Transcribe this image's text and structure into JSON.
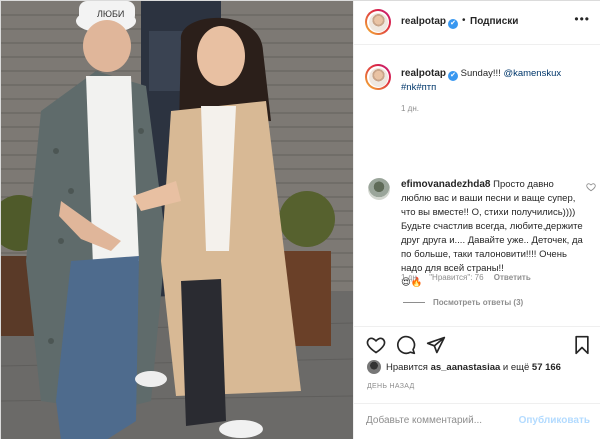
{
  "post": {
    "username": "realpotap",
    "follow_label": "Подписки",
    "dot": "•",
    "more": "•••",
    "verified_icon": "✔"
  },
  "caption": {
    "username": "realpotap",
    "text": "Sunday!!! ",
    "mention": "@kamenskux",
    "hashtags": "#nk#птп",
    "time": "1 дн."
  },
  "comment": {
    "username": "efimovanadezhda8",
    "text": "Просто давно люблю вас и ваши песни и ваще супер, что вы вместе!! О, стихи получились)))) Будьте счастлив всегда, любите,держите друг друга и.... Давайте уже.. Деточек, да по больше, таки талоновити!!!! Очень надо для всей страны!!",
    "emoji": "😍🔥",
    "time": "1 дн.",
    "likes": "\"Нравится\": 76",
    "reply_label": "Ответить",
    "view_replies": "Посмотреть ответы (3)"
  },
  "actions": {
    "liked_prefix": "Нравится ",
    "liked_user": "as_aanastasiaa",
    "liked_mid": " и ещё ",
    "liked_count": "57 166",
    "date": "ДЕНЬ НАЗАД"
  },
  "add_comment": {
    "placeholder": "Добавьте комментарий...",
    "publish_label": "Опубликовать"
  },
  "photo": {
    "cap_text": "ЛЮБИ"
  },
  "colors": {
    "link": "#00376b",
    "verified": "#3897f0",
    "muted": "#8e8e8e",
    "publish_disabled": "#b3dbff"
  }
}
